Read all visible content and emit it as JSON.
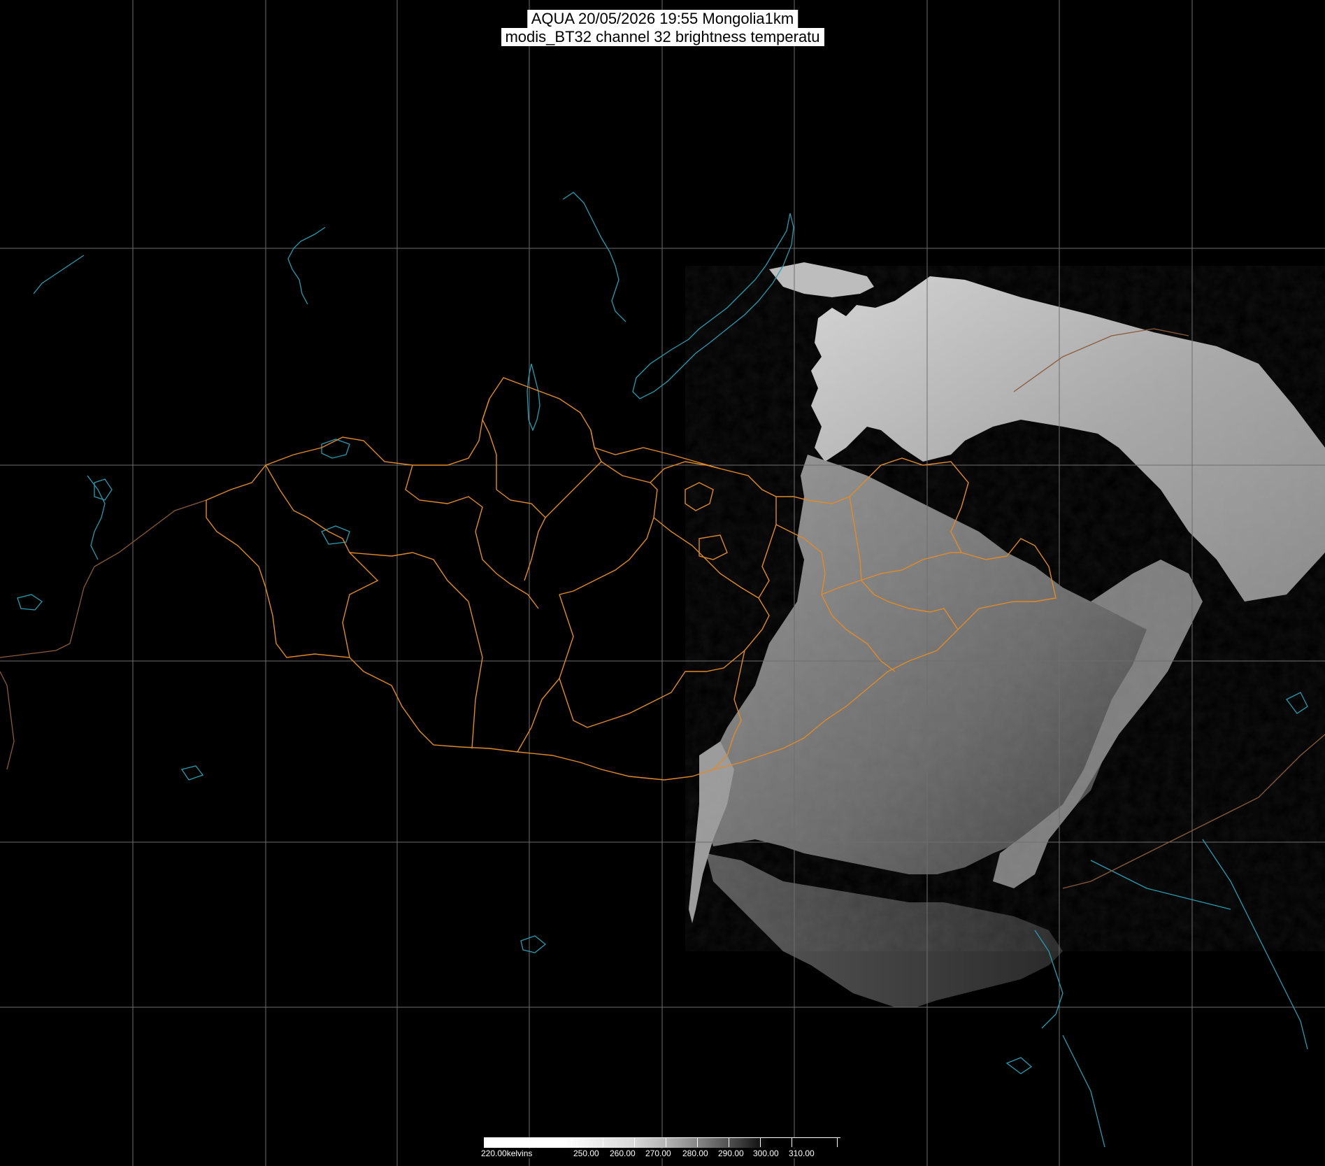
{
  "title": {
    "line1": "AQUA 20/05/2026 19:55 Mongolia1km",
    "line2": "modis_BT32 channel 32 brightness temperatu"
  },
  "map": {
    "background": "#000000",
    "grid_color": "#6e6e6e",
    "border_color": "#e08a2a",
    "coast_color": "#2a9bb0",
    "international_border_color": "#8a5a3a"
  },
  "colorbar": {
    "unit_label": "220.00kelvins",
    "tick_labels": [
      "250.00",
      "260.00",
      "270.00",
      "280.00",
      "290.00",
      "300.00",
      "310.00"
    ],
    "min": 220,
    "max": 310
  }
}
